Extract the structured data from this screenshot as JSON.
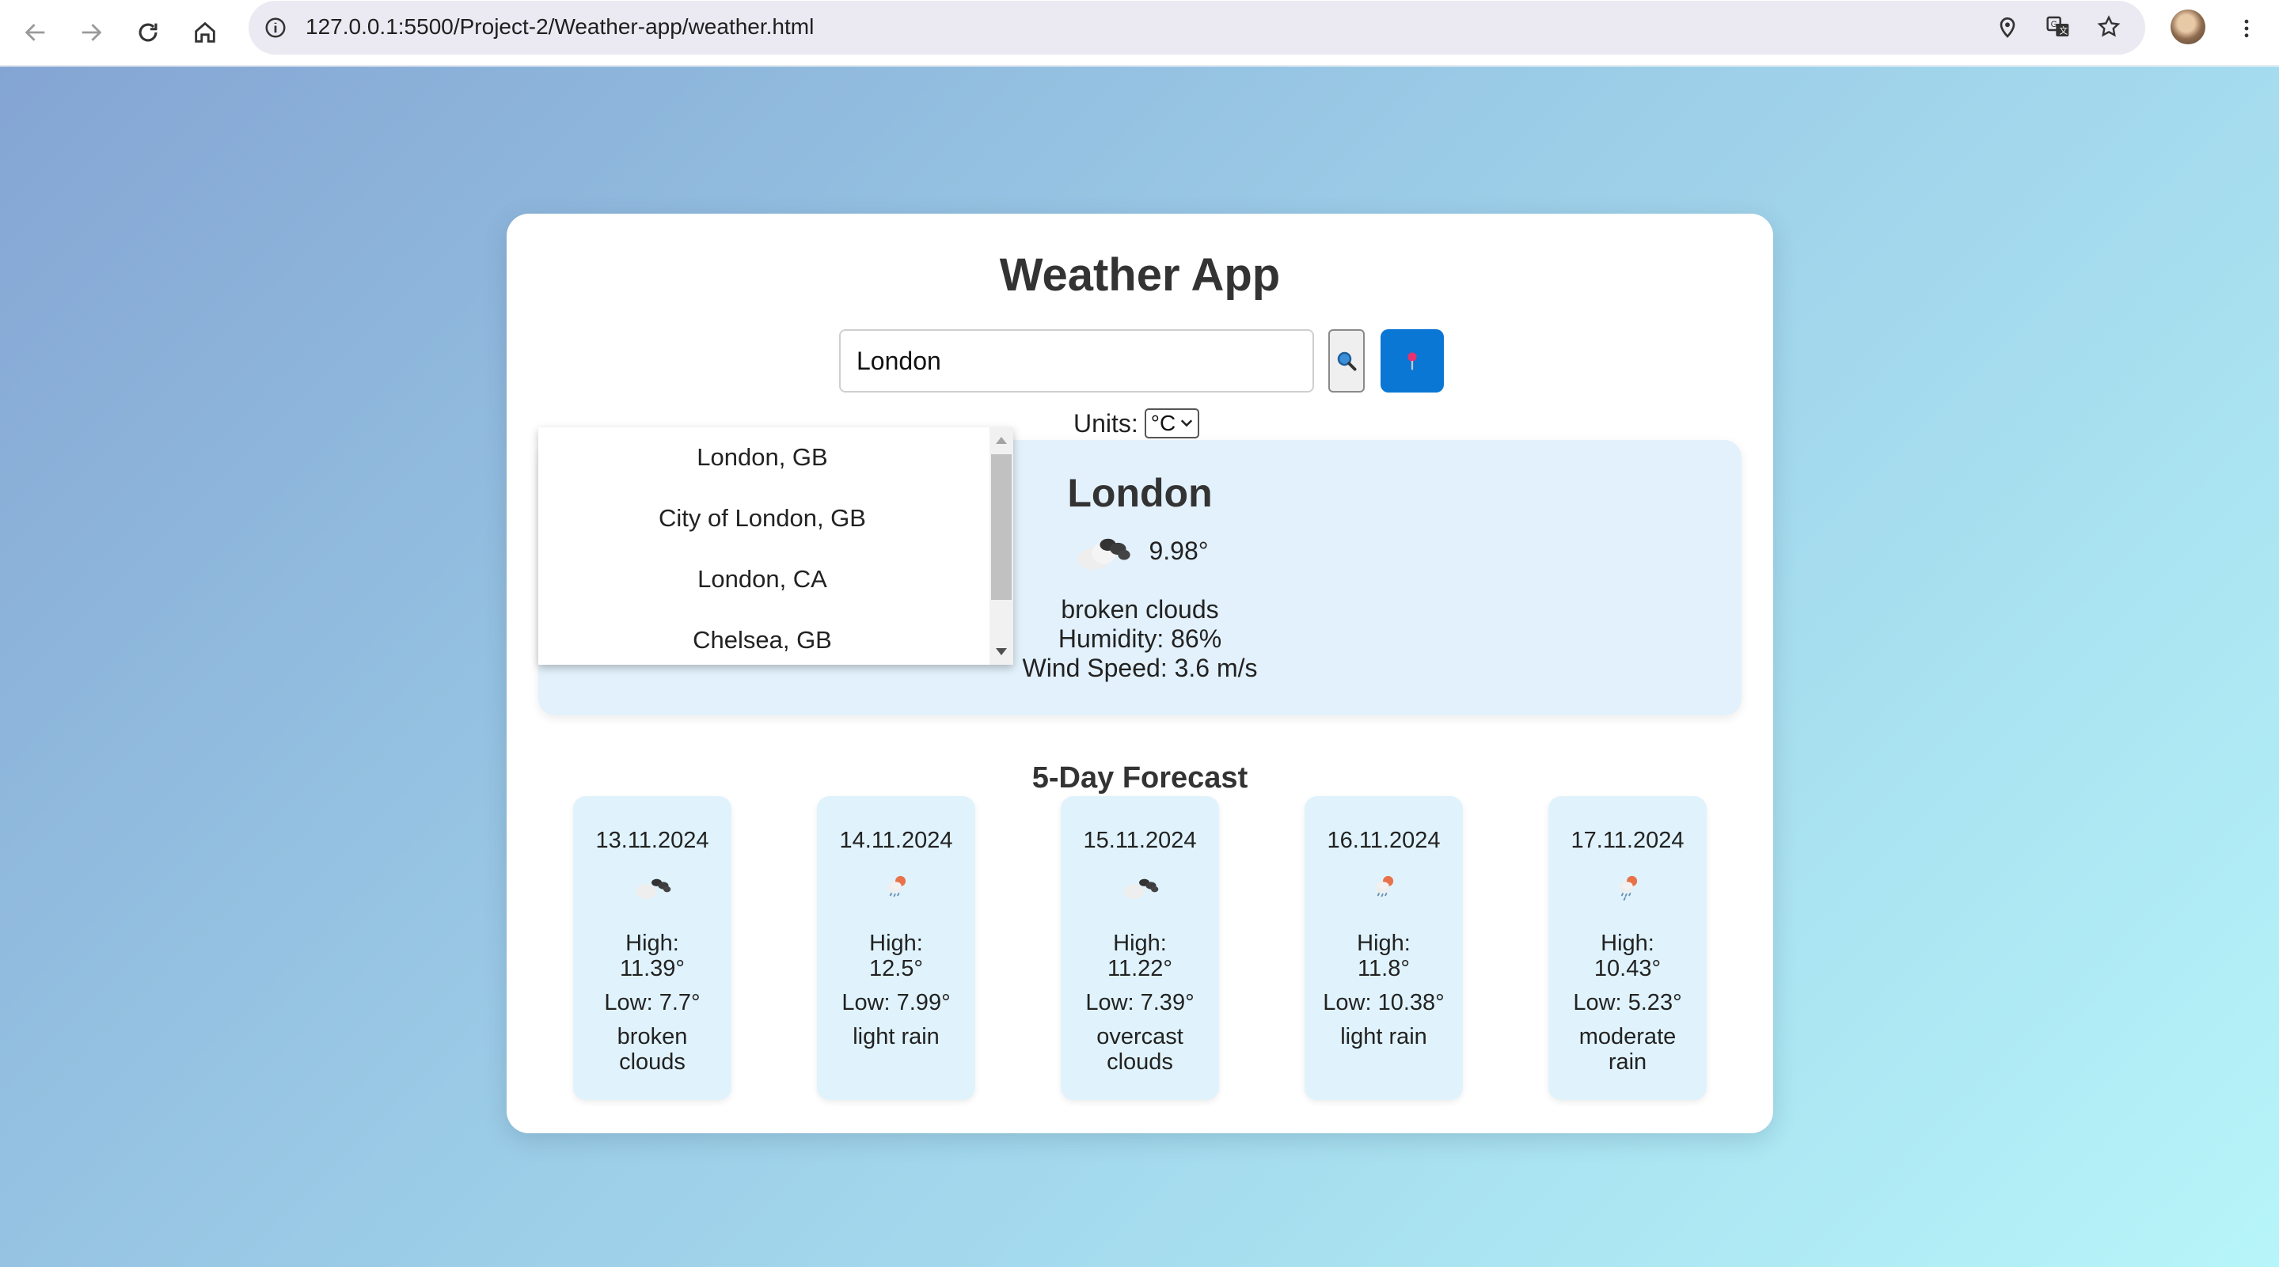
{
  "browser": {
    "url": "127.0.0.1:5500/Project-2/Weather-app/weather.html"
  },
  "app": {
    "title": "Weather App",
    "search": {
      "value": "London",
      "search_icon": "magnifier-icon",
      "location_icon": "pushpin-icon"
    },
    "units": {
      "label": "Units:",
      "selected": "°C"
    },
    "suggestions": [
      "London, GB",
      "City of London, GB",
      "London, CA",
      "Chelsea, GB"
    ],
    "current": {
      "city": "London",
      "temp": "9.98°",
      "icon": "broken-clouds-icon",
      "description": "broken clouds",
      "humidity": "Humidity: 86%",
      "wind": "Wind Speed: 3.6 m/s"
    },
    "forecast": {
      "title": "5-Day Forecast",
      "days": [
        {
          "date": "13.11.2024",
          "icon": "broken-clouds-icon",
          "high_label": "High:",
          "high": "11.39°",
          "low": "Low: 7.7°",
          "description": "broken clouds"
        },
        {
          "date": "14.11.2024",
          "icon": "light-rain-icon",
          "high_label": "High:",
          "high": "12.5°",
          "low": "Low: 7.99°",
          "description": "light rain"
        },
        {
          "date": "15.11.2024",
          "icon": "overcast-clouds-icon",
          "high_label": "High:",
          "high": "11.22°",
          "low": "Low: 7.39°",
          "description": "overcast clouds"
        },
        {
          "date": "16.11.2024",
          "icon": "light-rain-icon",
          "high_label": "High:",
          "high": "11.8°",
          "low": "Low: 10.38°",
          "description": "light rain"
        },
        {
          "date": "17.11.2024",
          "icon": "moderate-rain-icon",
          "high_label": "High:",
          "high": "10.43°",
          "low": "Low: 5.23°",
          "description": "moderate rain"
        }
      ]
    }
  },
  "colors": {
    "accent": "#0a77d5",
    "card_bg": "#e2f1fb",
    "forecast_bg": "#e0f3fc",
    "gradient_start": "#84a5d3",
    "gradient_end": "#b6f5f9"
  }
}
